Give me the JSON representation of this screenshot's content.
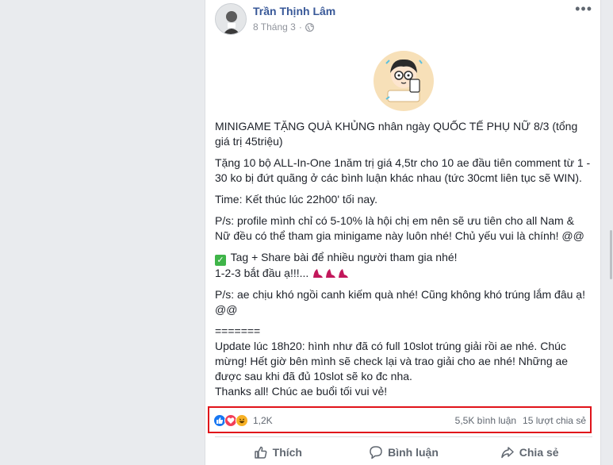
{
  "post": {
    "author": "Trần Thịnh Lâm",
    "date": "8 Tháng 3",
    "more": "•••",
    "paragraphs": {
      "p1": "MINIGAME TẶNG QUÀ KHỦNG nhân ngày QUỐC TẾ PHỤ NỮ 8/3 (tổng giá trị 45triệu)",
      "p2": "Tặng 10 bộ ALL-In-One 1năm trị giá 4,5tr cho 10 ae đầu tiên comment từ 1 - 30 ko bị đứt quãng ở các bình luận khác nhau (tức 30cmt liên tục sẽ WIN).",
      "p3": "Time: Kết thúc lúc 22h00' tối nay.",
      "p4": "P/s: profile mình chỉ có 5-10% là hội chị em nên sẽ ưu tiên cho all Nam & Nữ đều có thể tham gia minigame này luôn nhé! Chủ yếu vui là chính! @@",
      "p5a": "Tag + Share bài để nhiều người tham gia nhé!",
      "p5b": "1-2-3 bắt đầu ạ!!!...",
      "p6": "P/s: ae chịu khó ngồi canh kiếm quà nhé! Cũng không khó trúng lắm đâu ạ! @@",
      "sep": "=======",
      "u1": "Update lúc 18h20: hình như đã có full 10slot trúng giải rồi ae nhé. Chúc mừng! Hết giờ bên mình sẽ check lại và trao giải cho ae nhé! Những ae được sau khi đã đủ 10slot sẽ ko đc nha.",
      "u2": "Thanks all! Chúc ae buổi tối vui vẻ!"
    },
    "reactions": {
      "count": "1,2K",
      "types": [
        "like",
        "love",
        "haha"
      ],
      "colors": {
        "like": "#1877f2",
        "love": "#f33e58",
        "haha": "#f7b125"
      }
    },
    "stats": {
      "comments": "5,5K bình luận",
      "shares": "15 lượt chia sẻ"
    },
    "actions": {
      "like": "Thích",
      "comment": "Bình luận",
      "share": "Chia sẻ"
    }
  },
  "colors": {
    "highlight_border": "#e0131a",
    "author_link": "#385898"
  }
}
